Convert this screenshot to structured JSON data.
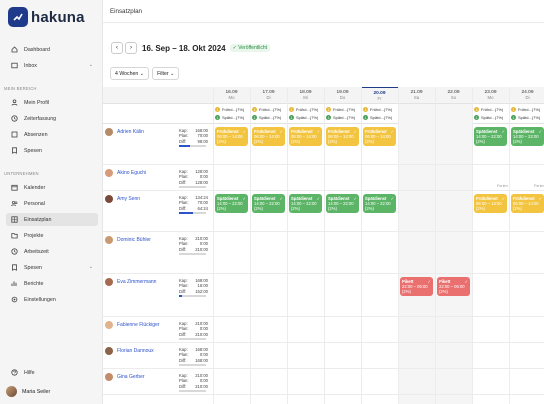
{
  "app": {
    "name": "hakuna",
    "page_title": "Einsatzplan"
  },
  "sidebar": {
    "items_top": [
      {
        "label": "Dashboard",
        "icon": "dashboard-icon"
      },
      {
        "label": "Inbox",
        "icon": "inbox-icon"
      }
    ],
    "section_mine": "MEIN BEREICH",
    "items_mine": [
      {
        "label": "Mein Profil",
        "icon": "user-icon"
      },
      {
        "label": "Zeiterfassung",
        "icon": "clock-icon"
      },
      {
        "label": "Absenzen",
        "icon": "absence-icon"
      },
      {
        "label": "Spesen",
        "icon": "receipt-icon"
      }
    ],
    "section_company": "UNTERNEHMEN",
    "items_company": [
      {
        "label": "Kalender",
        "icon": "calendar-icon"
      },
      {
        "label": "Personal",
        "icon": "people-icon"
      },
      {
        "label": "Einsatzplan",
        "icon": "schedule-icon"
      },
      {
        "label": "Projekte",
        "icon": "folder-icon"
      },
      {
        "label": "Arbeitszeit",
        "icon": "clock-icon"
      },
      {
        "label": "Spesen",
        "icon": "receipt-icon"
      },
      {
        "label": "Berichte",
        "icon": "chart-icon"
      },
      {
        "label": "Einstellungen",
        "icon": "gear-icon"
      }
    ],
    "help": "Hilfe",
    "user_name": "Maria Seiler"
  },
  "toolbar": {
    "date_range": "16. Sep – 18. Okt 2024",
    "status": "Veröffentlicht",
    "view": "4 Wochen",
    "filter": "Filter"
  },
  "days": [
    {
      "date": "16.09",
      "wd": "Mo"
    },
    {
      "date": "17.09",
      "wd": "Di"
    },
    {
      "date": "18.09",
      "wd": "Mi"
    },
    {
      "date": "19.09",
      "wd": "Do"
    },
    {
      "date": "20.09",
      "wd": "Fr"
    },
    {
      "date": "21.09",
      "wd": "Sa"
    },
    {
      "date": "22.09",
      "wd": "So"
    },
    {
      "date": "23.09",
      "wd": "Mo"
    },
    {
      "date": "24.09",
      "wd": "Di"
    }
  ],
  "summary": {
    "fruehd": "Frühd...",
    "spaetd": "Spätd...",
    "pikett": "Pikett",
    "pct": "(7%)",
    "pikett_pct": "(16%)"
  },
  "labels": {
    "kap": "Kap:",
    "plan": "Plan:",
    "diff": "Diff:",
    "ferien": "Ferien"
  },
  "shift_types": {
    "frueh": {
      "name": "Frühdienst",
      "time": "06:00 – 14:00",
      "pct": "(2%)"
    },
    "spaet": {
      "name": "Spätdienst",
      "time": "14:00 – 22:00",
      "pct": "(2%)"
    },
    "pikett": {
      "name": "Pikett",
      "time": "22:00 – 06:00",
      "pct": "(2%)"
    }
  },
  "employees": [
    {
      "name": "Adrien Kälin",
      "kap": "168:00",
      "plan": "70:00",
      "diff": "98:00",
      "fill": 0.42
    },
    {
      "name": "Akino Eguchi",
      "kap": "128:00",
      "plan": "0:00",
      "diff": "128:00",
      "fill": 0
    },
    {
      "name": "Amy Senn",
      "kap": "134:24",
      "plan": "70:00",
      "diff": "64:24",
      "fill": 0.52
    },
    {
      "name": "Dominic Bühler",
      "kap": "210:00",
      "plan": "0:00",
      "diff": "210:00",
      "fill": 0
    },
    {
      "name": "Eva Zimmermann",
      "kap": "168:00",
      "plan": "16:00",
      "diff": "152:00",
      "fill": 0.1
    },
    {
      "name": "Fabienne Flückiger",
      "kap": "210:00",
      "plan": "0:00",
      "diff": "210:00",
      "fill": 0
    },
    {
      "name": "Florian Dannoux",
      "kap": "168:00",
      "plan": "0:00",
      "diff": "168:00",
      "fill": 0
    },
    {
      "name": "Gina Gerber",
      "kap": "210:00",
      "plan": "0:00",
      "diff": "210:00",
      "fill": 0
    }
  ]
}
